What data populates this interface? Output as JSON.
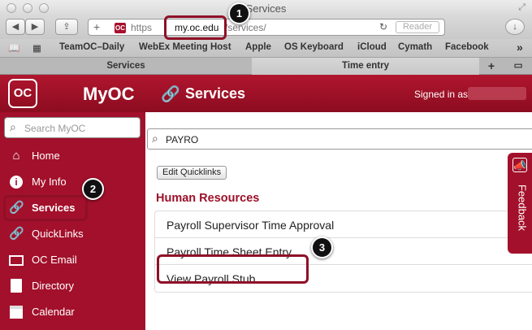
{
  "browser": {
    "window_title": "Services",
    "url_https": "https",
    "url_host": "my.oc.edu",
    "url_path": "/services/",
    "reader_label": "Reader",
    "bookmarks": [
      "TeamOC–Daily",
      "WebEx Meeting Host",
      "Apple",
      "OS Keyboard",
      "iCloud",
      "Cymath",
      "Facebook"
    ],
    "more_bookmarks": "»",
    "tabs": [
      "Services",
      "Time entry"
    ],
    "new_tab": "+"
  },
  "header": {
    "logo_text": "OC",
    "app_title": "MyOC",
    "page_title": "Services",
    "signed_in": "Signed in as"
  },
  "sidebar": {
    "search_placeholder": "Search MyOC",
    "items": [
      {
        "label": "Home"
      },
      {
        "label": "My Info"
      },
      {
        "label": "Services"
      },
      {
        "label": "QuickLinks"
      },
      {
        "label": "OC Email"
      },
      {
        "label": "Directory"
      },
      {
        "label": "Calendar"
      }
    ]
  },
  "main": {
    "search_value": "PAYRO",
    "edit_quicklinks": "Edit Quicklinks",
    "section_title": "Human Resources",
    "items": [
      {
        "label": "Payroll Supervisor Time Approval"
      },
      {
        "label": "Payroll Time Sheet Entry"
      },
      {
        "label": "View Payroll Stub"
      }
    ]
  },
  "feedback": {
    "label": "Feedback"
  },
  "callouts": [
    "1",
    "2",
    "3"
  ],
  "colors": {
    "brand": "#a3102b",
    "header": "#9a0f25",
    "callout": "#111111"
  }
}
